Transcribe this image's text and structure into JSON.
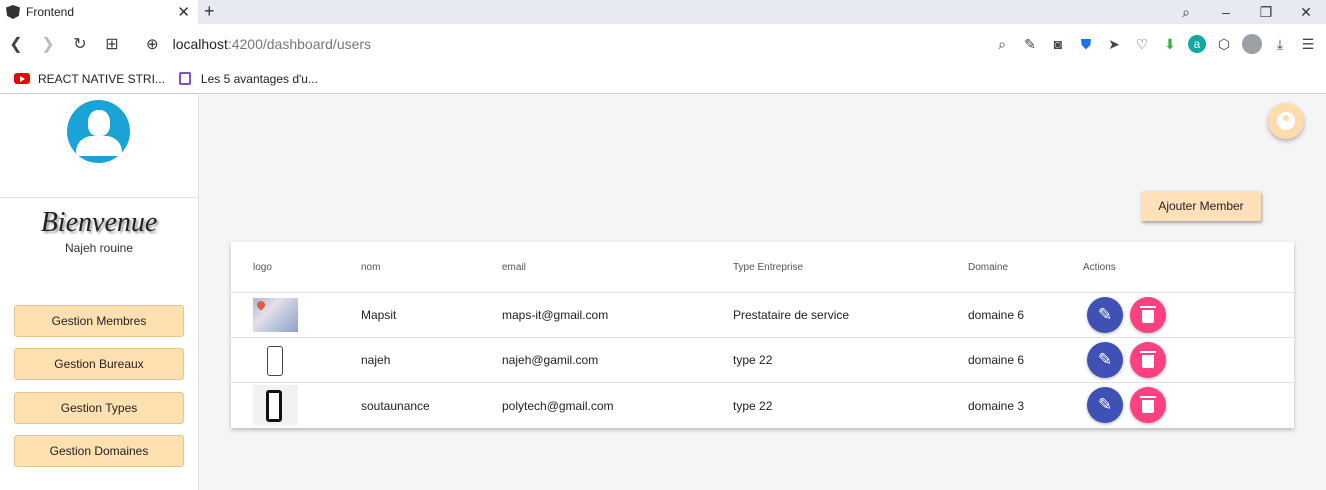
{
  "browser": {
    "tab_title": "Frontend",
    "tab_close": "✕",
    "new_tab": "+",
    "url_host": "localhost",
    "url_path": ":4200/dashboard/users",
    "bookmarks": [
      {
        "label": "REACT NATIVE STRI..."
      },
      {
        "label": "Les 5 avantages d'u..."
      }
    ],
    "icons": [
      "back-icon",
      "forward-icon",
      "reload-icon",
      "tabs-icon",
      "globe-icon",
      "zoom-icon",
      "edit-icon",
      "camera-icon",
      "shield-icon",
      "send-icon",
      "heart-icon",
      "download-extension-icon",
      "extension-a-icon",
      "cube-icon",
      "profile-icon",
      "download-icon",
      "menu-icon"
    ]
  },
  "sidebar": {
    "welcome": "Bienvenue",
    "user_name": "Najeh rouine",
    "buttons": [
      {
        "label": "Gestion Membres"
      },
      {
        "label": "Gestion Bureaux"
      },
      {
        "label": "Gestion Types"
      },
      {
        "label": "Gestion Domaines"
      }
    ]
  },
  "main": {
    "add_button": "Ajouter Member",
    "table": {
      "headers": [
        "logo",
        "nom",
        "email",
        "Type Entreprise",
        "Domaine",
        "Actions"
      ],
      "rows": [
        {
          "logo": "map-logo",
          "nom": "Mapsit",
          "email": "maps-it@gmail.com",
          "type": "Prestataire de service",
          "domaine": "domaine 6"
        },
        {
          "logo": "phone-outline-logo",
          "nom": "najeh",
          "email": "najeh@gamil.com",
          "type": "type 22",
          "domaine": "domaine 6"
        },
        {
          "logo": "phone-solid-logo",
          "nom": "soutaunance",
          "email": "polytech@gmail.com",
          "type": "type 22",
          "domaine": "domaine 3"
        }
      ]
    }
  },
  "colors": {
    "accent_orange": "#ffe0b0",
    "edit_button": "#3f51b5",
    "delete_button": "#ff4081",
    "avatar_blue": "#1aa3d6"
  }
}
